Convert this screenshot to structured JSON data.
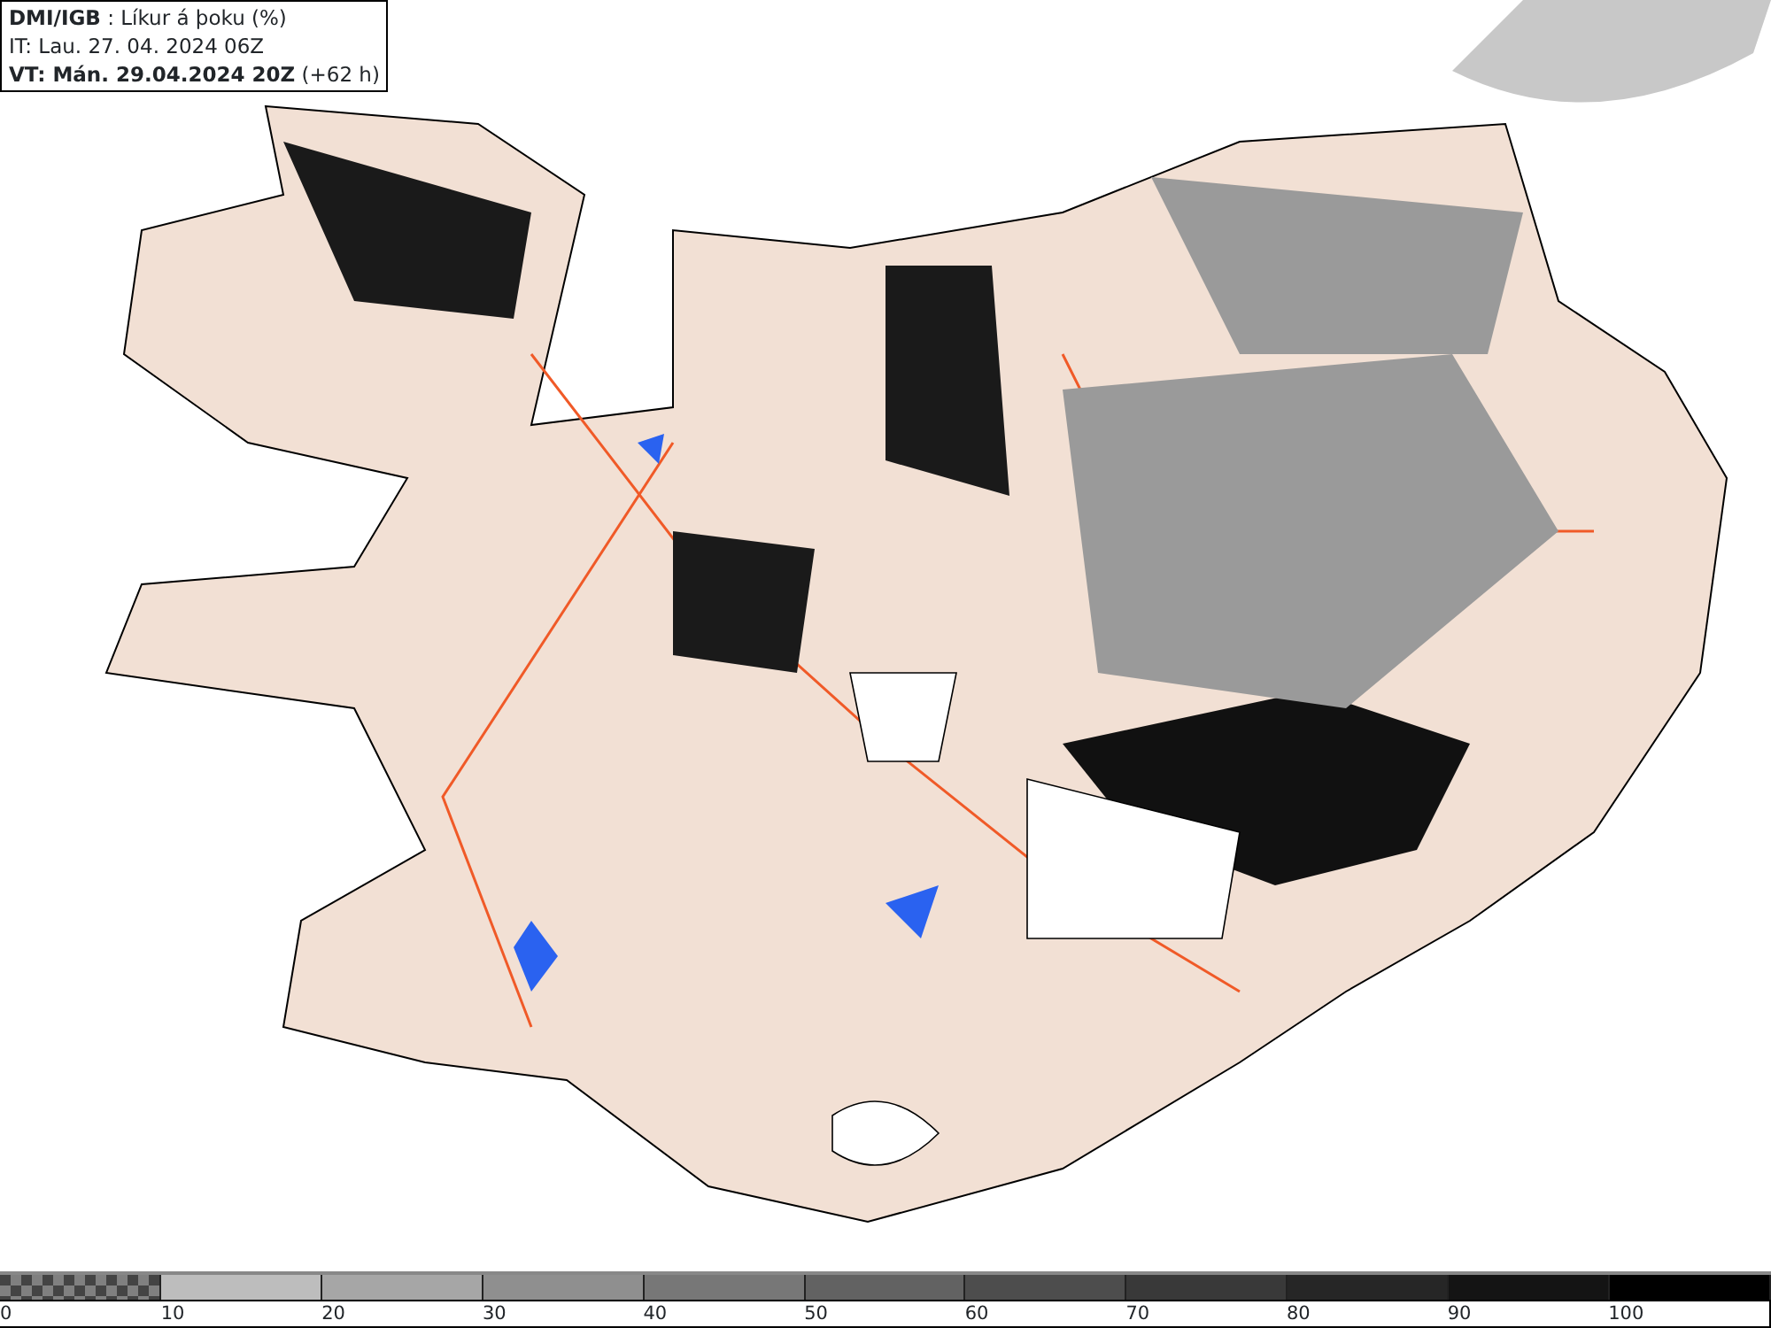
{
  "header": {
    "lines": [
      "**DMI/IGB** : Líkur á þoku (%)",
      "IT: Lau. 27. 04. 2024 06Z",
      "**VT: Mán. 29.04.2024 20Z** (+62 h)"
    ]
  },
  "legend": [
    {
      "label": "0",
      "kind": "checker"
    },
    {
      "label": "10",
      "color": "#bdbdbd",
      "kind": "solid"
    },
    {
      "label": "20",
      "color": "#a6a6a6",
      "kind": "solid"
    },
    {
      "label": "30",
      "color": "#8f8f8f",
      "kind": "solid"
    },
    {
      "label": "40",
      "color": "#777777",
      "kind": "solid"
    },
    {
      "label": "50",
      "color": "#626262",
      "kind": "solid"
    },
    {
      "label": "60",
      "color": "#4d4d4d",
      "kind": "solid"
    },
    {
      "label": "70",
      "color": "#393939",
      "kind": "solid"
    },
    {
      "label": "80",
      "color": "#262626",
      "kind": "solid"
    },
    {
      "label": "90",
      "color": "#141414",
      "kind": "solid"
    },
    {
      "label": "100",
      "color": "#000000",
      "kind": "solid"
    }
  ]
}
